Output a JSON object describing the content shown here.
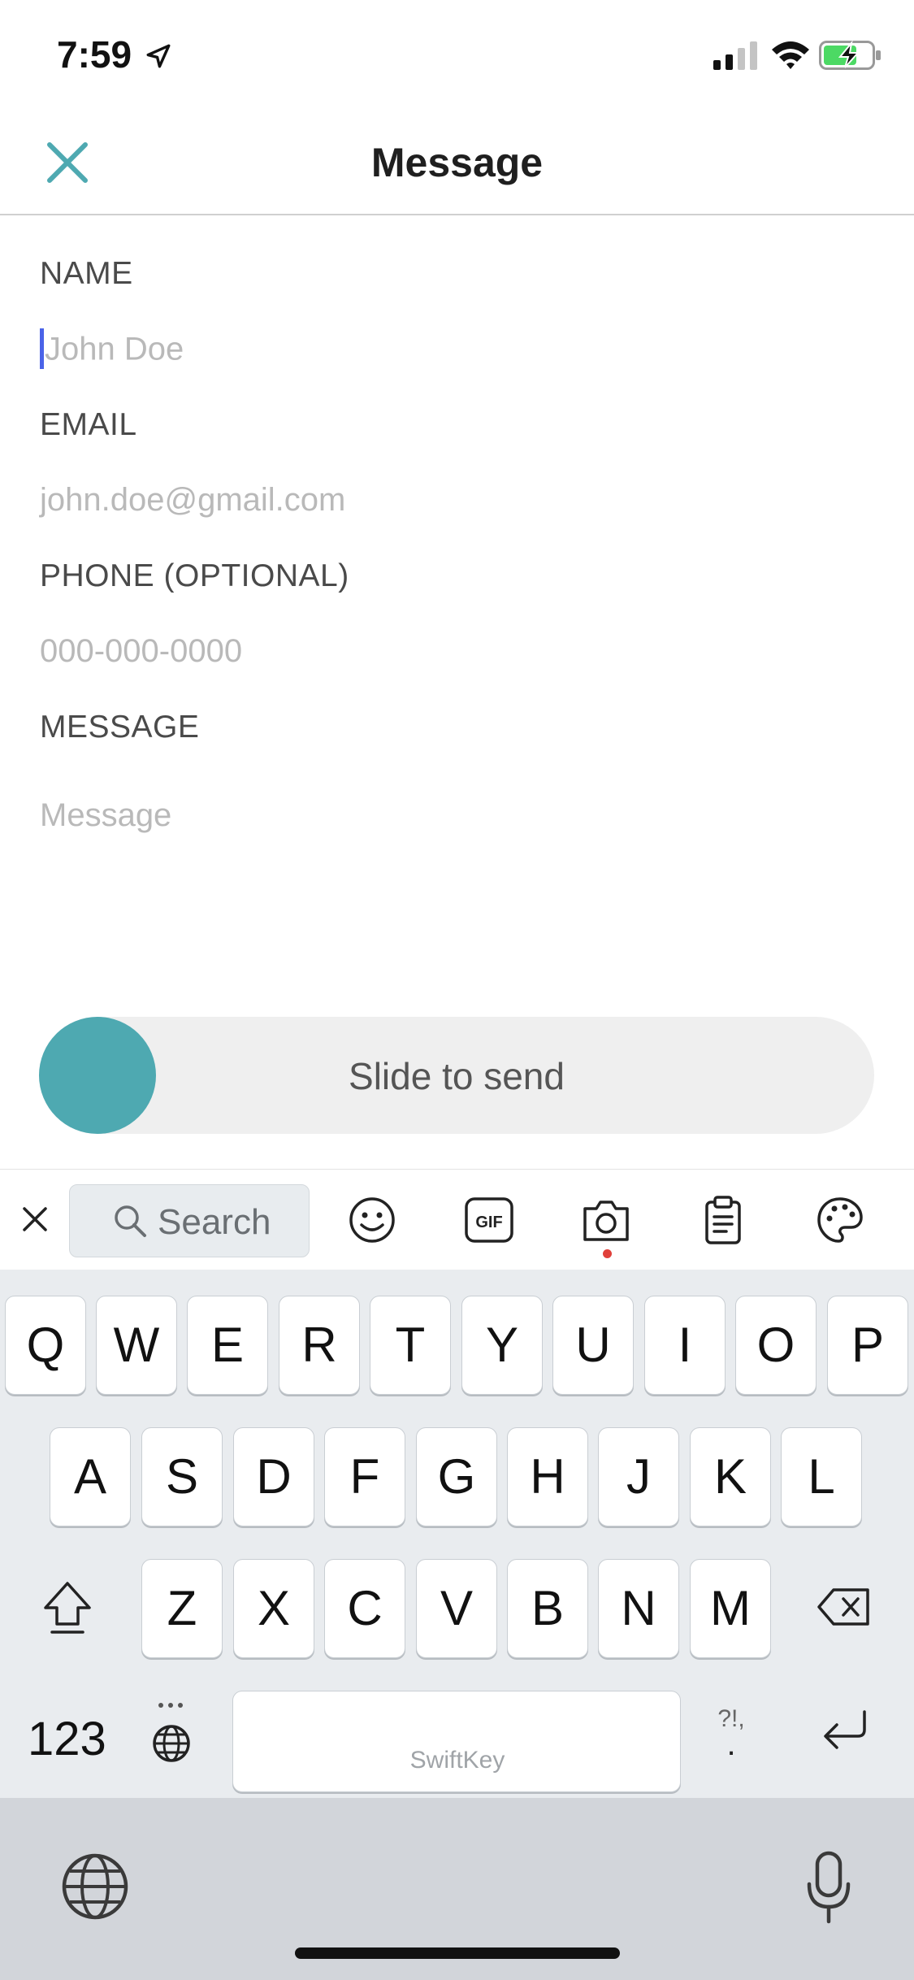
{
  "status_bar": {
    "time": "7:59"
  },
  "nav": {
    "title": "Message"
  },
  "form": {
    "name_label": "NAME",
    "name_placeholder": "John Doe",
    "email_label": "EMAIL",
    "email_placeholder": "john.doe@gmail.com",
    "phone_label": "PHONE (OPTIONAL)",
    "phone_placeholder": "000-000-0000",
    "message_label": "MESSAGE",
    "message_placeholder": "Message"
  },
  "slide": {
    "label": "Slide to send",
    "knob_color": "#4ea9b1"
  },
  "toolbar": {
    "search_placeholder": "Search",
    "icons": [
      "close-icon",
      "search-icon",
      "emoji-icon",
      "gif-icon",
      "camera-icon",
      "clipboard-icon",
      "palette-icon"
    ]
  },
  "keyboard": {
    "row1": [
      "Q",
      "W",
      "E",
      "R",
      "T",
      "Y",
      "U",
      "I",
      "O",
      "P"
    ],
    "row2": [
      "A",
      "S",
      "D",
      "F",
      "G",
      "H",
      "J",
      "K",
      "L"
    ],
    "row3": [
      "Z",
      "X",
      "C",
      "V",
      "B",
      "N",
      "M"
    ],
    "numbers_key": "123",
    "space_brand": "SwiftKey",
    "punct_top": "?!,",
    "punct_bottom": "."
  },
  "colors": {
    "accent": "#4ea9b1",
    "caret": "#4a63e8",
    "battery": "#4cd964"
  }
}
